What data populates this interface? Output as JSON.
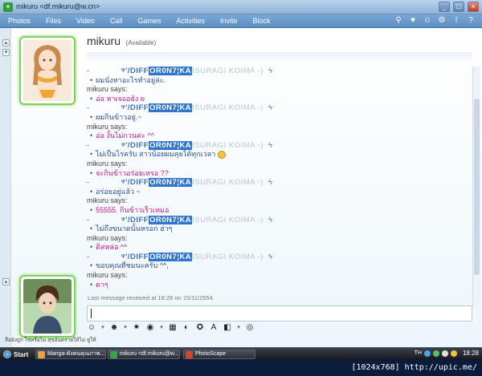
{
  "window": {
    "title": "mikuru <df.mikuru@w.cn>",
    "buttons": {
      "minimize": "_",
      "maximize": "□",
      "close": "×"
    }
  },
  "menubar": {
    "items": [
      "Photos",
      "Files",
      "Video",
      "Call",
      "Games",
      "Activities",
      "Invite",
      "Block"
    ]
  },
  "contact": {
    "name": "mikuru",
    "status": "(Available)"
  },
  "nickname": {
    "part1": "ᵠ′/DIFF",
    "part2": "OR0N7¦KA",
    "part3": "ISURAGI KOIMA -)"
  },
  "conversation": [
    {
      "kind": "nick",
      "text": ""
    },
    {
      "kind": "msg",
      "color": "blue",
      "text": "ผมนั่งหาอะไรทำอยู่ล่ะ."
    },
    {
      "kind": "says",
      "text": "mikuru says:"
    },
    {
      "kind": "msg",
      "color": "pink",
      "text": "อ่อ หาเจออยัง ผ"
    },
    {
      "kind": "nick",
      "text": ""
    },
    {
      "kind": "msg",
      "color": "blue",
      "text": "ผมกินข้าวอยู่.~"
    },
    {
      "kind": "says",
      "text": "mikuru says:"
    },
    {
      "kind": "msg",
      "color": "pink",
      "text": "อ่อ งั้นไม่กวนค่ะ ^^"
    },
    {
      "kind": "nick",
      "text": ""
    },
    {
      "kind": "msg",
      "color": "blue",
      "text": "ไม่เป็นไรครับ สาวน้อยผมคุยได้ทุกเวลา",
      "emoji": true
    },
    {
      "kind": "says",
      "text": "mikuru says:"
    },
    {
      "kind": "msg",
      "color": "pink",
      "text": "จะกินข้าวอร่อยเหรอ ??"
    },
    {
      "kind": "nick",
      "text": ""
    },
    {
      "kind": "msg",
      "color": "blue",
      "text": "อร่อยอยู่แล้ว ~"
    },
    {
      "kind": "says",
      "text": "mikuru says:"
    },
    {
      "kind": "msg",
      "color": "pink",
      "text": "55555. กินข้าวเร็วเหมอ"
    },
    {
      "kind": "nick",
      "text": ""
    },
    {
      "kind": "msg",
      "color": "blue",
      "text": "ไม่ถึงขนาดนั้นหรอก ฮ่าๆ"
    },
    {
      "kind": "says",
      "text": "mikuru says:"
    },
    {
      "kind": "msg",
      "color": "pink",
      "text": "ติสหล่อ ^^"
    },
    {
      "kind": "nick",
      "text": ""
    },
    {
      "kind": "msg",
      "color": "blue",
      "text": "ขอบคุณที่ชมนะครับ ^^,"
    },
    {
      "kind": "says",
      "text": "mikuru says:"
    },
    {
      "kind": "msg",
      "color": "pink",
      "text": "ดาๆ"
    }
  ],
  "last_message": "Last message received at 18:28 on 15/11/2554.",
  "status_line": "ลือยังถูก ใช่หรือไม่ สุขอันตรายให้ไม่ หูให้",
  "taskbar": {
    "start": "Start",
    "tasks": [
      "Manga-ดังคนคุณภาพ...",
      "mikuru <df.mikuru@w...",
      "PhotoScape"
    ],
    "lang": "TH",
    "clock": "18:28"
  },
  "watermark": "[1024x768] http://upic.me/",
  "colors": {
    "accent": "#5d8ec4",
    "pink": "#c2188c",
    "blue": "#2b4f9e",
    "avatar_border": "#7fd15a"
  },
  "icons": [
    "search-icon",
    "heart-icon",
    "smiley-icon",
    "settings-icon",
    "info-icon",
    "help-icon"
  ]
}
